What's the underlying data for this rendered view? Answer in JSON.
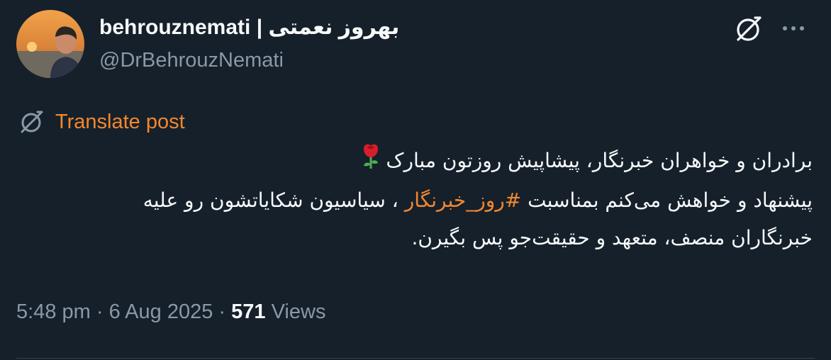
{
  "author": {
    "display_name": "behrouznemati | بهروز نعمتی",
    "handle": "@DrBehrouzNemati"
  },
  "actions": {
    "grok_icon": "grok-icon",
    "more_icon": "more-icon"
  },
  "translate": {
    "icon": "globe-slash-icon",
    "label": "Translate post"
  },
  "post": {
    "line1": "برادران و خواهران خبرنگار، پیشاپیش روزتون مبارک",
    "line1_emoji": "rose-icon",
    "line2_before": "پیشنهاد و خواهش می‌کنم بمناسبت",
    "hashtag": "#روز_خبرنگار",
    "line2_after": "، سیاسیون شکایاتشون رو علیه",
    "line3": "خبرنگاران منصف، متعهد و حقیقت‌جو پس بگیرن."
  },
  "meta": {
    "time": "5:48 pm",
    "separator": "·",
    "date": "6 Aug 2025",
    "views_count": "571",
    "views_label": "Views"
  },
  "colors": {
    "background": "#15202b",
    "text_primary": "#f7f9f9",
    "text_secondary": "#8b98a5",
    "accent": "#f3872f",
    "divider": "#38444d"
  }
}
